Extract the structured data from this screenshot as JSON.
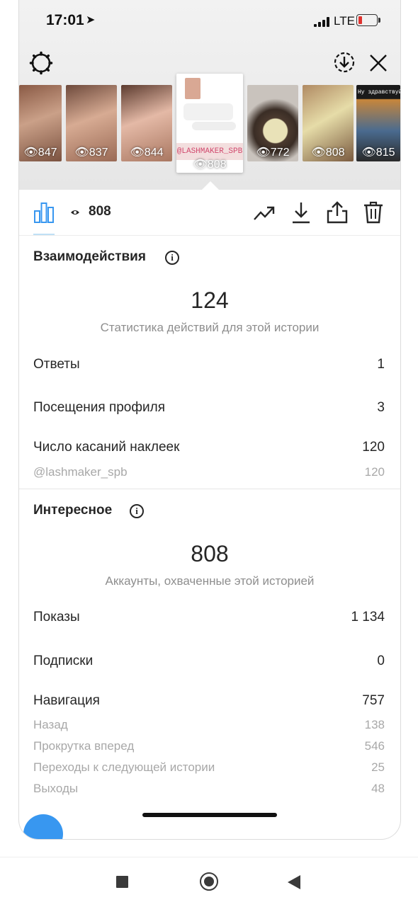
{
  "status_bar": {
    "time": "17:01",
    "network": "LTE"
  },
  "stories": [
    {
      "views": "847"
    },
    {
      "views": "837"
    },
    {
      "views": "844"
    },
    {
      "views": "808",
      "sticker_text": "@LASHMAKER_SPB"
    },
    {
      "views": "772"
    },
    {
      "views": "808"
    },
    {
      "views": "815",
      "caption": "Ну здравствуйте"
    }
  ],
  "toolbar": {
    "views": "808"
  },
  "interactions": {
    "title": "Взаимодействия",
    "total": "124",
    "subtitle": "Статистика действий для этой истории",
    "rows": [
      {
        "label": "Ответы",
        "value": "1"
      },
      {
        "label": "Посещения профиля",
        "value": "3"
      },
      {
        "label": "Число касаний наклеек",
        "value": "120"
      }
    ],
    "sticker": {
      "label": "@lashmaker_spb",
      "value": "120"
    }
  },
  "discovery": {
    "title": "Интересное",
    "total": "808",
    "subtitle": "Аккаунты, охваченные этой историей",
    "rows": [
      {
        "label": "Показы",
        "value": "1 134"
      },
      {
        "label": "Подписки",
        "value": "0"
      },
      {
        "label": "Навигация",
        "value": "757"
      }
    ],
    "navigation": [
      {
        "label": "Назад",
        "value": "138"
      },
      {
        "label": "Прокрутка вперед",
        "value": "546"
      },
      {
        "label": "Переходы к следующей истории",
        "value": "25"
      },
      {
        "label": "Выходы",
        "value": "48"
      }
    ]
  },
  "colors": {
    "accent": "#3897f0",
    "battery_low": "#e0332f",
    "muted_text": "#8e8e8e"
  },
  "icons": [
    "settings-icon",
    "download-icon",
    "close-icon",
    "bar-chart-icon",
    "eye-icon",
    "trending-icon",
    "save-icon",
    "share-icon",
    "trash-icon",
    "info-icon"
  ]
}
